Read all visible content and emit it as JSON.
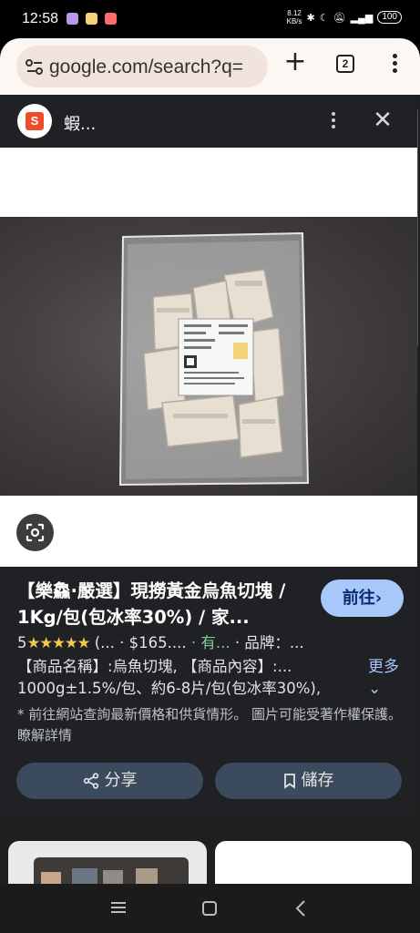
{
  "status_bar": {
    "time": "12:58",
    "net_speed_value": "8.12",
    "net_speed_unit": "KB/s",
    "battery": "100",
    "colors": [
      "#b89be8",
      "#f5d27a",
      "#ff6b6b"
    ]
  },
  "browser": {
    "url": "google.com/search?q=",
    "tab_count": "2"
  },
  "shop_header": {
    "site_name": "蝦...",
    "logo_letter": "S"
  },
  "product": {
    "title": "【樂鱻·嚴選】現撈黃金烏魚切塊 / 1Kg/包(包冰率30%) / 家...",
    "goto_label": "前往",
    "rating": "5",
    "stars": "★★★★★",
    "rating_tail": " (...",
    "price": " · $165....",
    "stock": " · 有...",
    "brand": " · 品牌：...",
    "description": "【商品名稱】:烏魚切塊, 【商品內容】:... 1000g±1.5%/包、約6-8片/包(包冰率30%),",
    "more_label": "更多",
    "note": "* 前往網站查詢最新價格和供貨情形。 圖片可能受著作權保護。 瞭解詳情",
    "share_label": "分享",
    "save_label": "儲存"
  },
  "accent_color": "#a8c7fa",
  "brand_color": "#ee4d2d"
}
